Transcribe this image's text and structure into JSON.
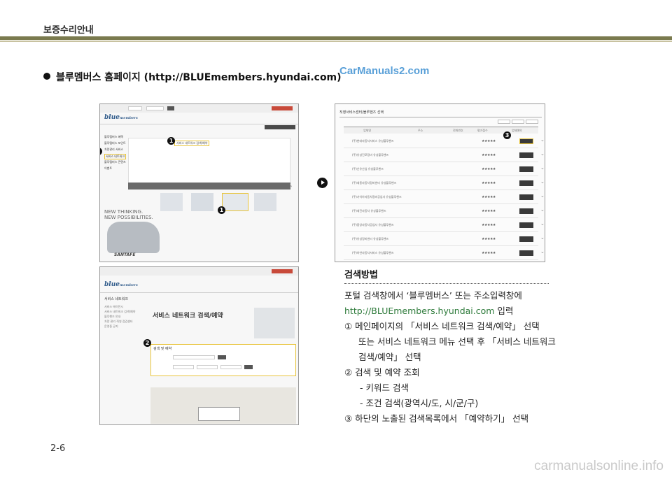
{
  "header": {
    "title": "보증수리안내"
  },
  "section": {
    "heading": "블루멤버스 홈페이지 (http://BLUEmembers.hyundai.com)"
  },
  "watermark_top": "CarManuals2.com",
  "screenshot1": {
    "logo": "blue",
    "logo_sub": "members",
    "menu": [
      "블루멤버스 혜택",
      "블루멤버스 포인트",
      "차량관리 서비스",
      "서비스 네트워크",
      "블루멤버스 콘텐츠",
      "이벤트"
    ],
    "nav_button": "서비스 네트워크 검색/예약",
    "slogan_line1": "NEW THINKING.",
    "slogan_line2": "NEW POSSIBILITIES.",
    "car_name": "SANTAFE"
  },
  "screenshot2": {
    "side_title": "서비스 네트워크",
    "side_items": [
      "서비스 에이전시",
      "서비스 네트워크 검색/예약",
      "블루핸즈 안내",
      "차량 관리 직영 점검센터",
      "운영중 공지"
    ],
    "page_title": "서비스 네트워크 검색/예약",
    "search_title": "검색 및 예약"
  },
  "screenshot3": {
    "title": "직영서비스센터/블루핸즈 선택",
    "columns": [
      "업체명",
      "주소",
      "전화번호",
      "평가점수",
      "업체예약"
    ],
    "rows": [
      {
        "name": "(주)현대자동차서비스 유성블루핸즈"
      },
      {
        "name": "(주)유성진로정비 유성블루핸즈"
      },
      {
        "name": "(주)산유산업 유성블루핸즈"
      },
      {
        "name": "(주)세종자동차정비센터 유성블루핸즈"
      },
      {
        "name": "(주)가이아자동차정비공업사 유성블루핸즈"
      },
      {
        "name": "(주)세진자동차 유성블루핸즈"
      },
      {
        "name": "(주)중앙자동차공업사 유성블루핸즈"
      },
      {
        "name": "(주)유성정비센터 유성블루핸즈"
      },
      {
        "name": "(주)하연자동차서비스 유성블루핸즈"
      }
    ],
    "reserve_label": "예약하기"
  },
  "markers": {
    "one": "1",
    "two": "2",
    "three": "3"
  },
  "method": {
    "title": "검색방법",
    "line1": "포털 검색창에서 ‘블루멤버스’ 또는 주소입력창에",
    "url": "http://BLUEmembers.hyundai.com",
    "url_suffix": " 입력",
    "step1a": "① 메인페이지의 「서비스 네트워크 검색/예약」 선택",
    "step1b": "또는 서비스 네트워크 메뉴 선택 후 「서비스 네트워크",
    "step1c": "검색/예약」 선택",
    "step2": "② 검색 및 예약 조회",
    "step2a": "- 키워드 검색",
    "step2b": "- 조건 검색(광역시/도, 시/군/구)",
    "step3": "③ 하단의 노출된 검색목록에서 「예약하기」 선택"
  },
  "footer": {
    "page_number": "2-6",
    "watermark": "carmanualsonline.info"
  }
}
